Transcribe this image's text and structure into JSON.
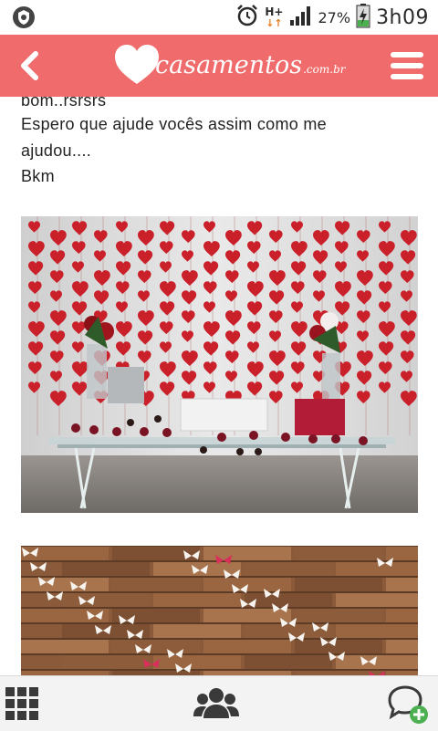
{
  "status_bar": {
    "network": "H+",
    "battery_percent": "27%",
    "time": "3h09",
    "icons": [
      "shield-app-icon",
      "alarm-icon",
      "network-arrows-icon",
      "signal-icon",
      "battery-charging-icon"
    ]
  },
  "app_bar": {
    "logo_main": "casamentos",
    "logo_suffix": ".com.br",
    "icons": [
      "back-arrow-icon",
      "heart-logo-icon",
      "hamburger-menu-icon"
    ]
  },
  "post": {
    "lines": [
      "bom..rsrsrs",
      "Espero que ajude vocês assim como me",
      "ajudou....",
      "Bkm"
    ]
  },
  "bottom_bar": {
    "icons": [
      "grid-menu-icon",
      "community-icon",
      "add-chat-icon"
    ]
  },
  "colors": {
    "brand": "#f06b6b",
    "heart_red": "#c9202a",
    "wood": "#8a5a3a",
    "new_green": "#4caf50"
  }
}
